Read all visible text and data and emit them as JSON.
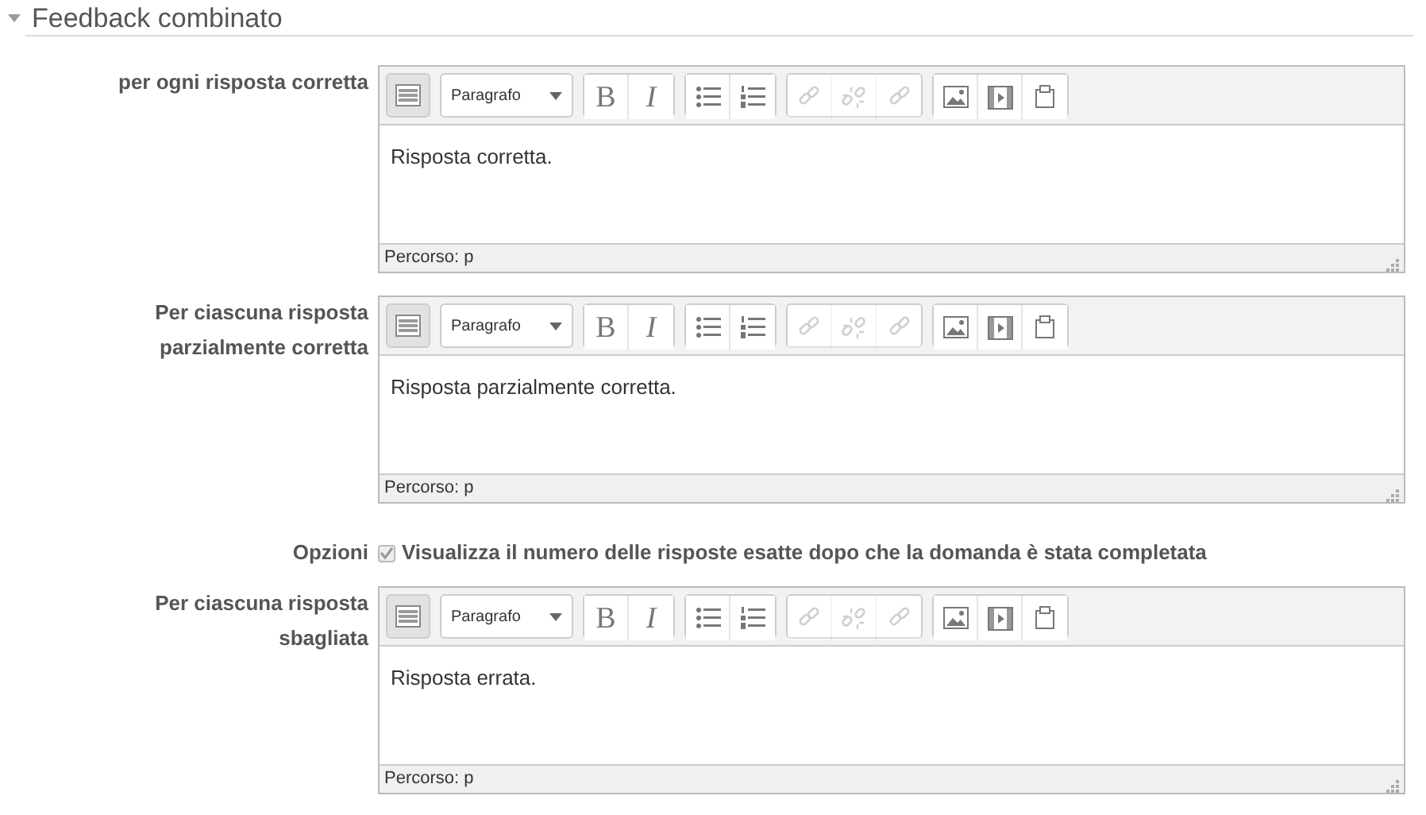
{
  "section": {
    "title": "Feedback combinato",
    "expanded": true
  },
  "fields": [
    {
      "kind": "editor",
      "label": "per ogni risposta corretta",
      "format": "Paragrafo",
      "content": "Risposta corretta.",
      "path": "Percorso: p",
      "toolbar": [
        {
          "kind": "toggle",
          "pressed": true,
          "disabled": false
        },
        {
          "kind": "bold",
          "label": "B",
          "disabled": false
        },
        {
          "kind": "italic",
          "label": "I",
          "disabled": false
        },
        {
          "kind": "bullets",
          "disabled": false
        },
        {
          "kind": "numbers",
          "disabled": false
        },
        {
          "kind": "link",
          "disabled": true
        },
        {
          "kind": "unlink",
          "disabled": true
        },
        {
          "kind": "anchor",
          "disabled": true
        },
        {
          "kind": "image",
          "disabled": false
        },
        {
          "kind": "media",
          "disabled": false
        },
        {
          "kind": "files",
          "disabled": false
        }
      ]
    },
    {
      "kind": "editor",
      "label": "Per ciascuna risposta parzialmente corretta",
      "format": "Paragrafo",
      "content": "Risposta parzialmente corretta.",
      "path": "Percorso: p",
      "toolbar": [
        {
          "kind": "toggle",
          "pressed": true,
          "disabled": false
        },
        {
          "kind": "bold",
          "label": "B",
          "disabled": false
        },
        {
          "kind": "italic",
          "label": "I",
          "disabled": false
        },
        {
          "kind": "bullets",
          "disabled": false
        },
        {
          "kind": "numbers",
          "disabled": false
        },
        {
          "kind": "link",
          "disabled": true
        },
        {
          "kind": "unlink",
          "disabled": true
        },
        {
          "kind": "anchor",
          "disabled": true
        },
        {
          "kind": "image",
          "disabled": false
        },
        {
          "kind": "media",
          "disabled": false
        },
        {
          "kind": "files",
          "disabled": false
        }
      ]
    },
    {
      "kind": "checkbox",
      "label": "Opzioni",
      "text": "Visualizza il numero delle risposte esatte dopo che la domanda è stata completata",
      "checked": true,
      "disabled": true
    },
    {
      "kind": "editor",
      "label": "Per ciascuna risposta sbagliata",
      "format": "Paragrafo",
      "content": "Risposta errata.",
      "path": "Percorso: p",
      "toolbar": [
        {
          "kind": "toggle",
          "pressed": true,
          "disabled": false
        },
        {
          "kind": "bold",
          "label": "B",
          "disabled": false
        },
        {
          "kind": "italic",
          "label": "I",
          "disabled": false
        },
        {
          "kind": "bullets",
          "disabled": false
        },
        {
          "kind": "numbers",
          "disabled": false
        },
        {
          "kind": "link",
          "disabled": true
        },
        {
          "kind": "unlink",
          "disabled": true
        },
        {
          "kind": "anchor",
          "disabled": true
        },
        {
          "kind": "image",
          "disabled": false
        },
        {
          "kind": "media",
          "disabled": false
        },
        {
          "kind": "files",
          "disabled": false
        }
      ]
    }
  ]
}
